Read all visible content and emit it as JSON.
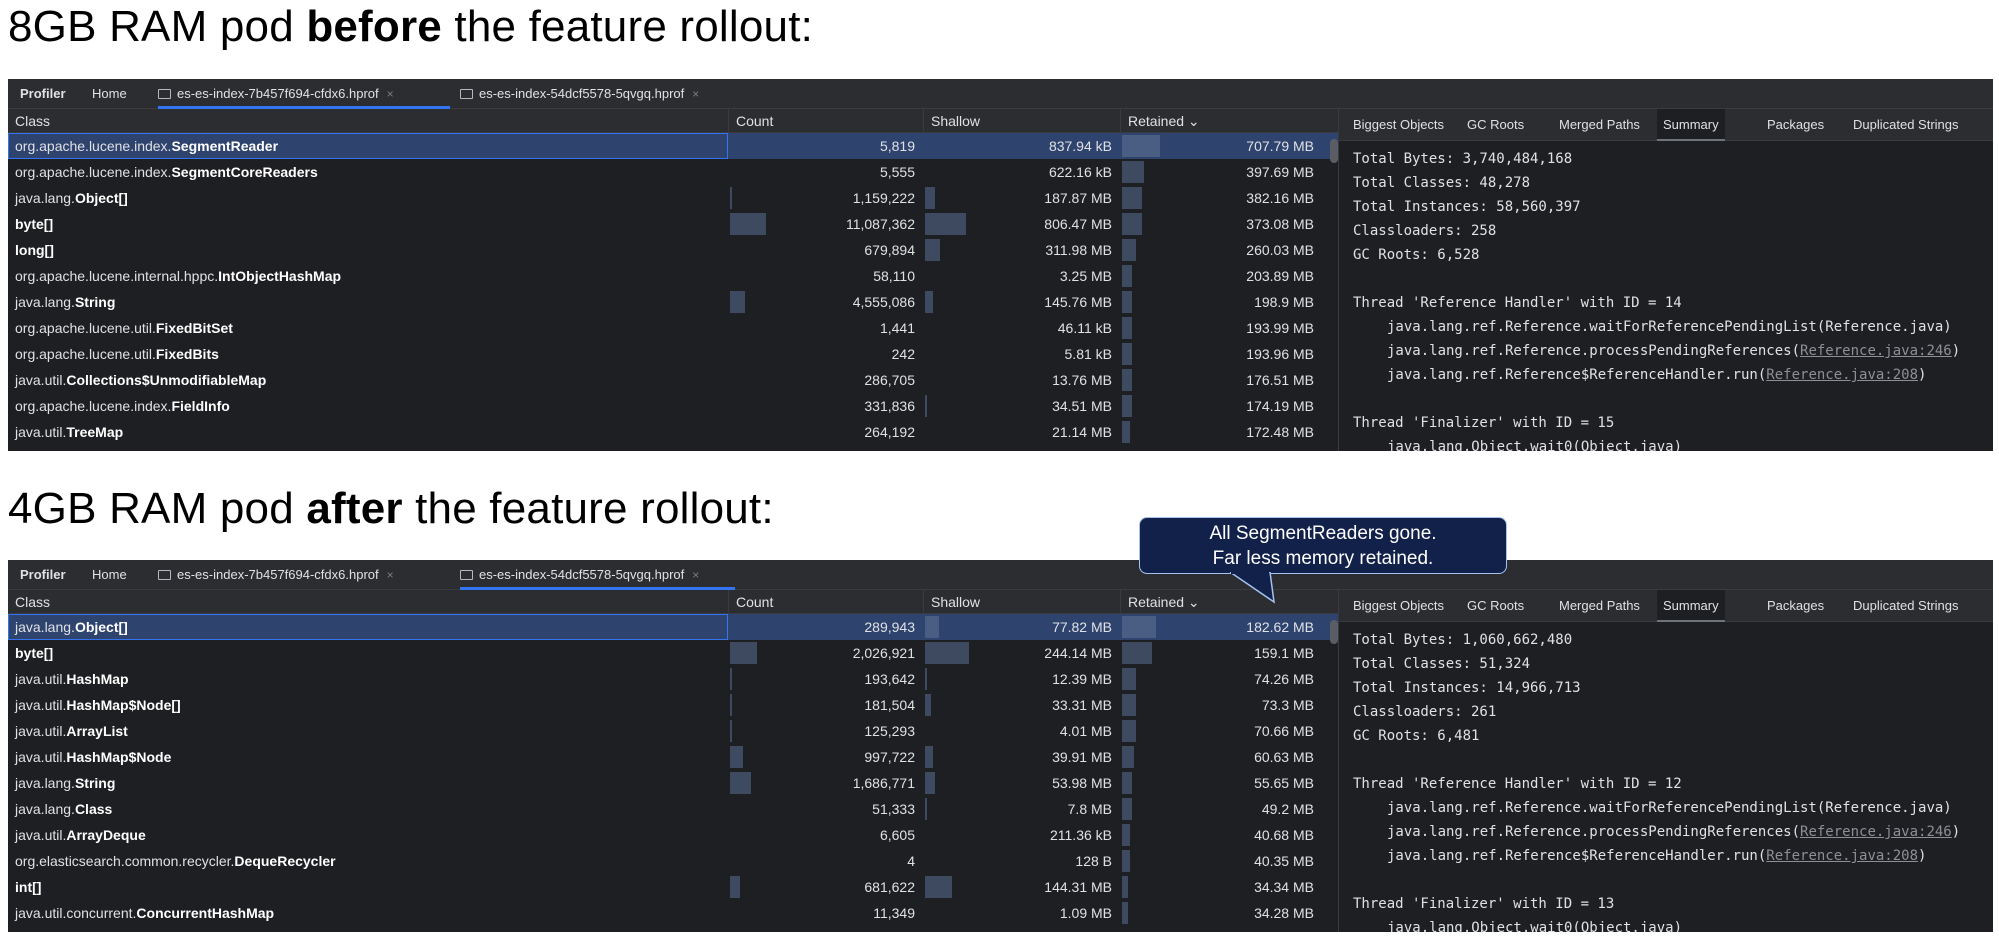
{
  "sections": [
    {
      "heading_pre": "8GB RAM pod ",
      "heading_bold": "before",
      "heading_post": " the feature rollout:",
      "tabs": [
        {
          "label": "Profiler",
          "kind": "profiler"
        },
        {
          "label": "Home",
          "kind": "plain"
        },
        {
          "label": "es-es-index-7b457f694-cfdx6.hprof",
          "kind": "file",
          "active": true
        },
        {
          "label": "es-es-index-54dcf5578-5qvgq.hprof",
          "kind": "file",
          "active": false
        }
      ],
      "columns": {
        "class": "Class",
        "count": "Count",
        "shallow": "Shallow",
        "retained": "Retained ⌄"
      },
      "rows": [
        {
          "pkg": "org.apache.lucene.index.",
          "name": "SegmentReader",
          "count": "5,819",
          "shallow": "837.94 kB",
          "retained": "707.79 MB",
          "count_frac": 0.0,
          "shallow_frac": 0.0,
          "retained_frac": 0.19
        },
        {
          "pkg": "org.apache.lucene.index.",
          "name": "SegmentCoreReaders",
          "count": "5,555",
          "shallow": "622.16 kB",
          "retained": "397.69 MB",
          "count_frac": 0.0,
          "shallow_frac": 0.0,
          "retained_frac": 0.11
        },
        {
          "pkg": "java.lang.",
          "name": "Object[]",
          "count": "1,159,222",
          "shallow": "187.87 MB",
          "retained": "382.16 MB",
          "count_frac": 0.01,
          "shallow_frac": 0.05,
          "retained_frac": 0.1
        },
        {
          "pkg": "",
          "name": "byte[]",
          "count": "11,087,362",
          "shallow": "806.47 MB",
          "retained": "373.08 MB",
          "count_frac": 0.19,
          "shallow_frac": 0.21,
          "retained_frac": 0.1
        },
        {
          "pkg": "",
          "name": "long[]",
          "count": "679,894",
          "shallow": "311.98 MB",
          "retained": "260.03 MB",
          "count_frac": 0.0,
          "shallow_frac": 0.08,
          "retained_frac": 0.07
        },
        {
          "pkg": "org.apache.lucene.internal.hppc.",
          "name": "IntObjectHashMap",
          "count": "58,110",
          "shallow": "3.25 MB",
          "retained": "203.89 MB",
          "count_frac": 0.0,
          "shallow_frac": 0.0,
          "retained_frac": 0.05
        },
        {
          "pkg": "java.lang.",
          "name": "String",
          "count": "4,555,086",
          "shallow": "145.76 MB",
          "retained": "198.9 MB",
          "count_frac": 0.08,
          "shallow_frac": 0.04,
          "retained_frac": 0.05
        },
        {
          "pkg": "org.apache.lucene.util.",
          "name": "FixedBitSet",
          "count": "1,441",
          "shallow": "46.11 kB",
          "retained": "193.99 MB",
          "count_frac": 0.0,
          "shallow_frac": 0.0,
          "retained_frac": 0.05
        },
        {
          "pkg": "org.apache.lucene.util.",
          "name": "FixedBits",
          "count": "242",
          "shallow": "5.81 kB",
          "retained": "193.96 MB",
          "count_frac": 0.0,
          "shallow_frac": 0.0,
          "retained_frac": 0.05
        },
        {
          "pkg": "java.util.",
          "name": "Collections$UnmodifiableMap",
          "count": "286,705",
          "shallow": "13.76 MB",
          "retained": "176.51 MB",
          "count_frac": 0.0,
          "shallow_frac": 0.0,
          "retained_frac": 0.05
        },
        {
          "pkg": "org.apache.lucene.index.",
          "name": "FieldInfo",
          "count": "331,836",
          "shallow": "34.51 MB",
          "retained": "174.19 MB",
          "count_frac": 0.0,
          "shallow_frac": 0.01,
          "retained_frac": 0.05
        },
        {
          "pkg": "java.util.",
          "name": "TreeMap",
          "count": "264,192",
          "shallow": "21.14 MB",
          "retained": "172.48 MB",
          "count_frac": 0.0,
          "shallow_frac": 0.0,
          "retained_frac": 0.04
        }
      ],
      "summary_tabs": [
        "Biggest Objects",
        "GC Roots",
        "Merged Paths",
        "Summary",
        "Packages",
        "Duplicated Strings"
      ],
      "summary_active": "Summary",
      "summary": {
        "total_bytes": "Total Bytes: 3,740,484,168",
        "total_classes": "Total Classes: 48,278",
        "total_instances": "Total Instances: 58,560,397",
        "classloaders": "Classloaders: 258",
        "gc_roots": "GC Roots: 6,528",
        "thread1": "Thread 'Reference Handler' with ID = 14",
        "t1_line1": "java.lang.ref.Reference.waitForReferencePendingList(Reference.java)",
        "t1_line2_pre": "java.lang.ref.Reference.processPendingReferences(",
        "t1_line2_link": "Reference.java:246",
        "t1_line3_pre": "java.lang.ref.Reference$ReferenceHandler.run(",
        "t1_line3_link": "Reference.java:208",
        "thread2": "Thread 'Finalizer' with ID = 15",
        "t2_line1": "java.lang.Object.wait0(Object.java)"
      }
    },
    {
      "heading_pre": "4GB RAM pod ",
      "heading_bold": "after",
      "heading_post": " the feature rollout:",
      "tabs": [
        {
          "label": "Profiler",
          "kind": "profiler"
        },
        {
          "label": "Home",
          "kind": "plain"
        },
        {
          "label": "es-es-index-7b457f694-cfdx6.hprof",
          "kind": "file",
          "active": false
        },
        {
          "label": "es-es-index-54dcf5578-5qvgq.hprof",
          "kind": "file",
          "active": true
        }
      ],
      "columns": {
        "class": "Class",
        "count": "Count",
        "shallow": "Shallow",
        "retained": "Retained ⌄"
      },
      "rows": [
        {
          "pkg": "java.lang.",
          "name": "Object[]",
          "count": "289,943",
          "shallow": "77.82 MB",
          "retained": "182.62 MB",
          "count_frac": 0.0,
          "shallow_frac": 0.07,
          "retained_frac": 0.17
        },
        {
          "pkg": "",
          "name": "byte[]",
          "count": "2,026,921",
          "shallow": "244.14 MB",
          "retained": "159.1 MB",
          "count_frac": 0.14,
          "shallow_frac": 0.23,
          "retained_frac": 0.15
        },
        {
          "pkg": "java.util.",
          "name": "HashMap",
          "count": "193,642",
          "shallow": "12.39 MB",
          "retained": "74.26 MB",
          "count_frac": 0.01,
          "shallow_frac": 0.01,
          "retained_frac": 0.07
        },
        {
          "pkg": "java.util.",
          "name": "HashMap$Node[]",
          "count": "181,504",
          "shallow": "33.31 MB",
          "retained": "73.3 MB",
          "count_frac": 0.01,
          "shallow_frac": 0.03,
          "retained_frac": 0.07
        },
        {
          "pkg": "java.util.",
          "name": "ArrayList",
          "count": "125,293",
          "shallow": "4.01 MB",
          "retained": "70.66 MB",
          "count_frac": 0.01,
          "shallow_frac": 0.0,
          "retained_frac": 0.07
        },
        {
          "pkg": "java.util.",
          "name": "HashMap$Node",
          "count": "997,722",
          "shallow": "39.91 MB",
          "retained": "60.63 MB",
          "count_frac": 0.07,
          "shallow_frac": 0.04,
          "retained_frac": 0.06
        },
        {
          "pkg": "java.lang.",
          "name": "String",
          "count": "1,686,771",
          "shallow": "53.98 MB",
          "retained": "55.65 MB",
          "count_frac": 0.11,
          "shallow_frac": 0.05,
          "retained_frac": 0.05
        },
        {
          "pkg": "java.lang.",
          "name": "Class",
          "count": "51,333",
          "shallow": "7.8 MB",
          "retained": "49.2 MB",
          "count_frac": 0.0,
          "shallow_frac": 0.01,
          "retained_frac": 0.05
        },
        {
          "pkg": "java.util.",
          "name": "ArrayDeque",
          "count": "6,605",
          "shallow": "211.36 kB",
          "retained": "40.68 MB",
          "count_frac": 0.0,
          "shallow_frac": 0.0,
          "retained_frac": 0.04
        },
        {
          "pkg": "org.elasticsearch.common.recycler.",
          "name": "DequeRecycler",
          "count": "4",
          "shallow": "128 B",
          "retained": "40.35 MB",
          "count_frac": 0.0,
          "shallow_frac": 0.0,
          "retained_frac": 0.04
        },
        {
          "pkg": "",
          "name": "int[]",
          "count": "681,622",
          "shallow": "144.31 MB",
          "retained": "34.34 MB",
          "count_frac": 0.05,
          "shallow_frac": 0.14,
          "retained_frac": 0.03
        },
        {
          "pkg": "java.util.concurrent.",
          "name": "ConcurrentHashMap",
          "count": "11,349",
          "shallow": "1.09 MB",
          "retained": "34.28 MB",
          "count_frac": 0.0,
          "shallow_frac": 0.0,
          "retained_frac": 0.03
        }
      ],
      "summary_tabs": [
        "Biggest Objects",
        "GC Roots",
        "Merged Paths",
        "Summary",
        "Packages",
        "Duplicated Strings"
      ],
      "summary_active": "Summary",
      "summary": {
        "total_bytes": "Total Bytes: 1,060,662,480",
        "total_classes": "Total Classes: 51,324",
        "total_instances": "Total Instances: 14,966,713",
        "classloaders": "Classloaders: 261",
        "gc_roots": "GC Roots: 6,481",
        "thread1": "Thread 'Reference Handler' with ID = 12",
        "t1_line1": "java.lang.ref.Reference.waitForReferencePendingList(Reference.java)",
        "t1_line2_pre": "java.lang.ref.Reference.processPendingReferences(",
        "t1_line2_link": "Reference.java:246",
        "t1_line3_pre": "java.lang.ref.Reference$ReferenceHandler.run(",
        "t1_line3_link": "Reference.java:208",
        "thread2": "Thread 'Finalizer' with ID = 13",
        "t2_line1": "java.lang.Object.wait0(Object.java)"
      }
    }
  ],
  "callout": {
    "line1": "All SegmentReaders gone.",
    "line2": "Far less memory retained."
  },
  "colors": {
    "panel_bg": "#1e1f22",
    "selected_row": "#2e436e",
    "accent": "#3574f0",
    "callout_bg": "#12214a"
  }
}
